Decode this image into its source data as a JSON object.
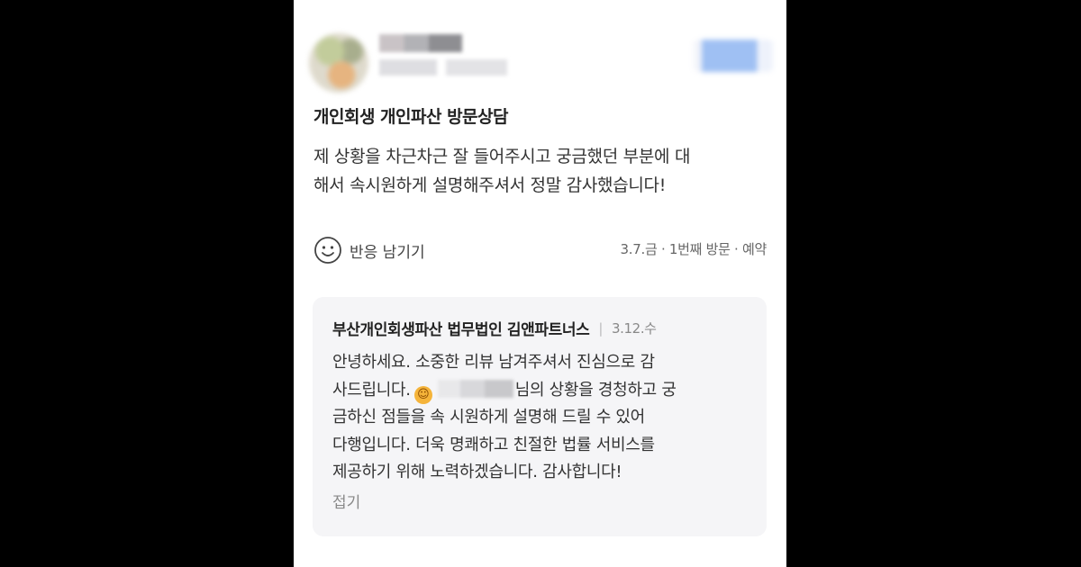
{
  "review": {
    "title": "개인회생 개인파산 방문상담",
    "body_line1": "제 상황을 차근차근 잘 들어주시고 궁금했던 부분에 대",
    "body_line2": "해서 속시원하게 설명해주셔서 정말 감사했습니다!",
    "react_label": "반응 남기기",
    "visit_meta": "3.7.금 · 1번째 방문 · 예약"
  },
  "reply": {
    "author": "부산개인회생파산 법무법인 김앤파트너스",
    "separator": "|",
    "date": "3.12.수",
    "line1": "안녕하세요. 소중한 리뷰 남겨주셔서 진심으로 감",
    "line2_prefix": "사드립니다.",
    "line2_suffix": "님의 상황을 경청하고 궁",
    "line3": "금하신 점들을 속 시원하게 설명해 드릴 수 있어",
    "line4": "다행입니다. 더욱 명쾌하고 친절한 법률 서비스를",
    "line5": "제공하기 위해 노력하겠습니다. 감사합니다!",
    "collapse_label": "접기"
  },
  "icons": {
    "react": "smile-icon",
    "emoji": "smiling-face-emoji"
  },
  "colors": {
    "background": "#000000",
    "card": "#ffffff",
    "reply_bg": "#f5f5f7"
  }
}
